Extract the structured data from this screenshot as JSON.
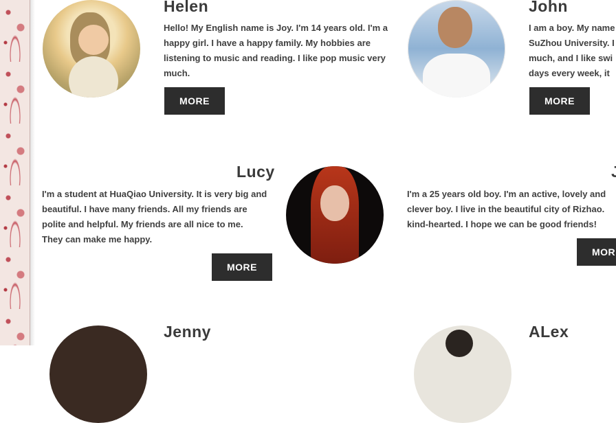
{
  "profiles": {
    "helen": {
      "name": "Helen",
      "bio": [
        "Hello! My English name is Joy. I'm 14 years old. I'm a",
        "happy girl. I have a happy family. My hobbies are",
        "listening to music and reading. I like pop music very",
        "much."
      ],
      "more_label": "MORE"
    },
    "john": {
      "name": "John",
      "bio": [
        "I am a boy. My name",
        "SuZhou University. I",
        "much, and I like swi",
        "days every week, it"
      ],
      "more_label": "MORE"
    },
    "lucy": {
      "name": "Lucy",
      "bio": [
        "I'm a student at HuaQiao University. It is very big and",
        "beautiful. I have many friends. All my friends are",
        "polite and helpful. My friends are all nice to me.",
        "They can make me happy."
      ],
      "more_label": "MORE"
    },
    "right_middle": {
      "name": "J",
      "bio": [
        "I'm a 25 years old boy. I'm an active, lovely and",
        "clever boy. I live in the beautiful city of Rizhao.",
        "kind-hearted. I hope we can be good friends!"
      ],
      "more_label": "MOR"
    },
    "jenny": {
      "name": "Jenny"
    },
    "alex": {
      "name": "ALex"
    }
  },
  "icons": {
    "decoration": "floral-pattern",
    "photos": [
      "helen-photo",
      "john-photo",
      "lucy-photo",
      "jenny-photo",
      "alex-photo"
    ]
  },
  "colors": {
    "button_bg": "#2d2d2d",
    "button_text": "#ffffff",
    "text": "#3f3f3f",
    "floral_accent": "#c0505a"
  }
}
